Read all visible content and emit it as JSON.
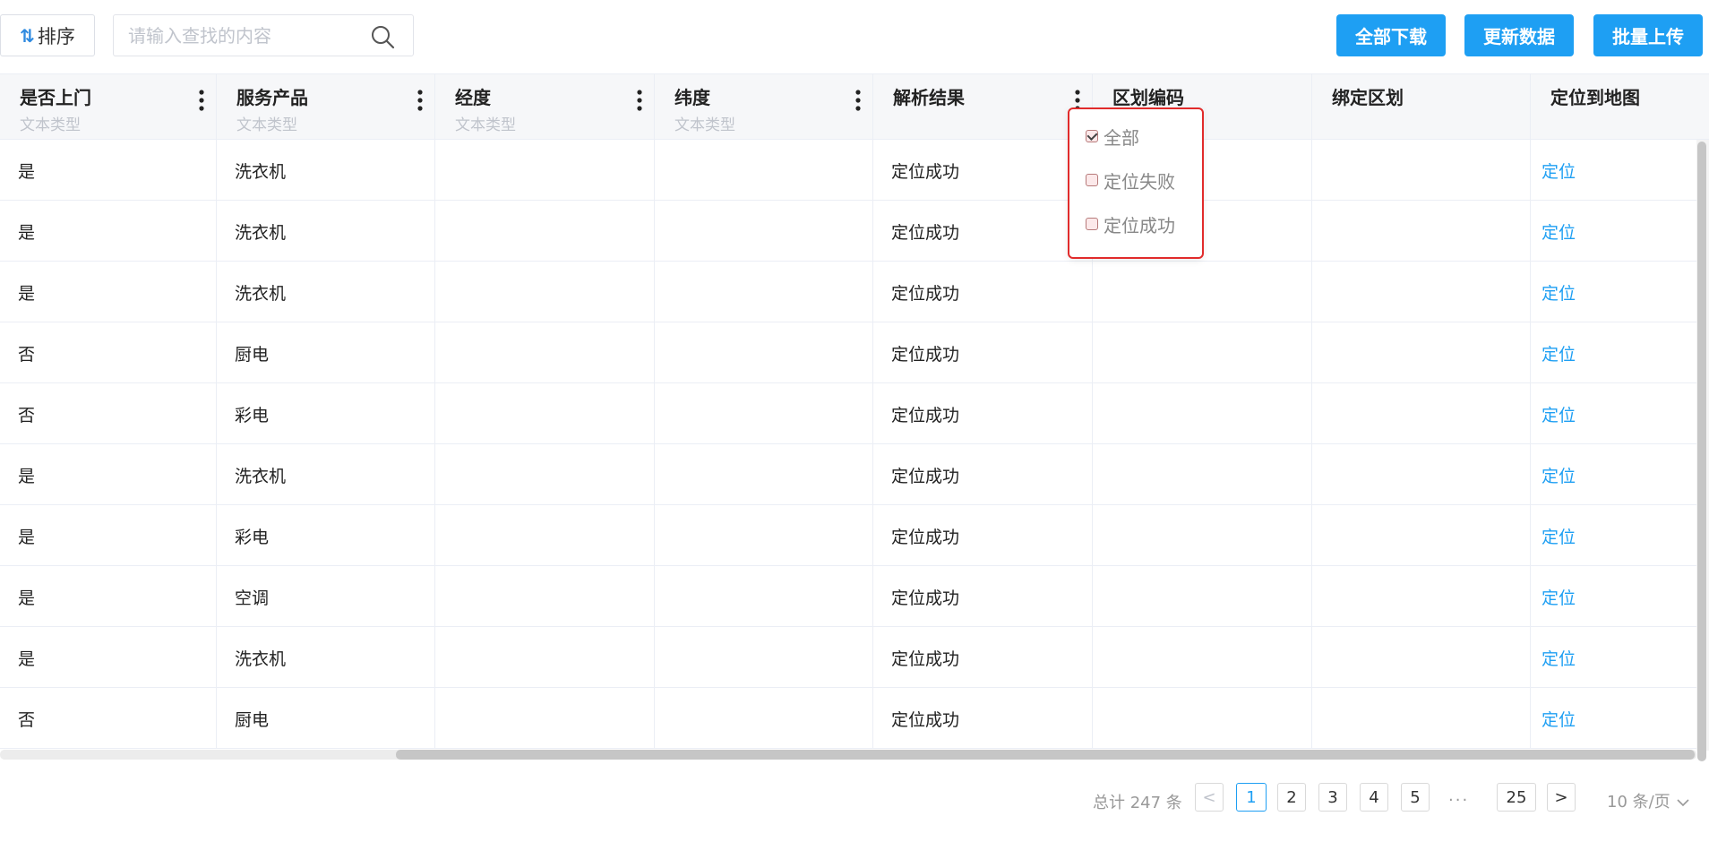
{
  "toolbar": {
    "sort_label": "排序",
    "search_placeholder": "请输入查找的内容",
    "download_all": "全部下载",
    "update_data": "更新数据",
    "batch_upload": "批量上传"
  },
  "columns": [
    {
      "title": "是否上门",
      "subtitle": "文本类型"
    },
    {
      "title": "服务产品",
      "subtitle": "文本类型"
    },
    {
      "title": "经度",
      "subtitle": "文本类型"
    },
    {
      "title": "纬度",
      "subtitle": "文本类型"
    },
    {
      "title": "解析结果",
      "subtitle": ""
    },
    {
      "title": "区划编码",
      "subtitle": ""
    },
    {
      "title": "绑定区划",
      "subtitle": ""
    },
    {
      "title": "定位到地图",
      "subtitle": ""
    }
  ],
  "rows": [
    {
      "visit": "是",
      "product": "洗衣机",
      "lng": "",
      "lat": "",
      "result": "定位成功",
      "code": "",
      "bind": "",
      "action": "定位"
    },
    {
      "visit": "是",
      "product": "洗衣机",
      "lng": "",
      "lat": "",
      "result": "定位成功",
      "code": "",
      "bind": "",
      "action": "定位"
    },
    {
      "visit": "是",
      "product": "洗衣机",
      "lng": "",
      "lat": "",
      "result": "定位成功",
      "code": "",
      "bind": "",
      "action": "定位"
    },
    {
      "visit": "否",
      "product": "厨电",
      "lng": "",
      "lat": "",
      "result": "定位成功",
      "code": "",
      "bind": "",
      "action": "定位"
    },
    {
      "visit": "否",
      "product": "彩电",
      "lng": "",
      "lat": "",
      "result": "定位成功",
      "code": "",
      "bind": "",
      "action": "定位"
    },
    {
      "visit": "是",
      "product": "洗衣机",
      "lng": "",
      "lat": "",
      "result": "定位成功",
      "code": "",
      "bind": "",
      "action": "定位"
    },
    {
      "visit": "是",
      "product": "彩电",
      "lng": "",
      "lat": "",
      "result": "定位成功",
      "code": "",
      "bind": "",
      "action": "定位"
    },
    {
      "visit": "是",
      "product": "空调",
      "lng": "",
      "lat": "",
      "result": "定位成功",
      "code": "",
      "bind": "",
      "action": "定位"
    },
    {
      "visit": "是",
      "product": "洗衣机",
      "lng": "",
      "lat": "",
      "result": "定位成功",
      "code": "",
      "bind": "",
      "action": "定位"
    },
    {
      "visit": "否",
      "product": "厨电",
      "lng": "",
      "lat": "",
      "result": "定位成功",
      "code": "",
      "bind": "",
      "action": "定位"
    }
  ],
  "filter": {
    "options": [
      {
        "label": "全部",
        "checked": true
      },
      {
        "label": "定位失败",
        "checked": false
      },
      {
        "label": "定位成功",
        "checked": false
      }
    ]
  },
  "pagination": {
    "total": "总计 247 条",
    "prev": "<",
    "next": ">",
    "pages": [
      "1",
      "2",
      "3",
      "4",
      "5"
    ],
    "ellipsis": "...",
    "last": "25",
    "current": "1",
    "page_size": "10 条/页"
  },
  "colors": {
    "accent": "#1e9ff3",
    "highlight_border": "#e12b2b"
  },
  "icons": {
    "sort": "sort-icon",
    "search": "search-icon",
    "column_menu": "kebab-menu-icon",
    "page_size_dropdown": "chevron-down-icon"
  }
}
